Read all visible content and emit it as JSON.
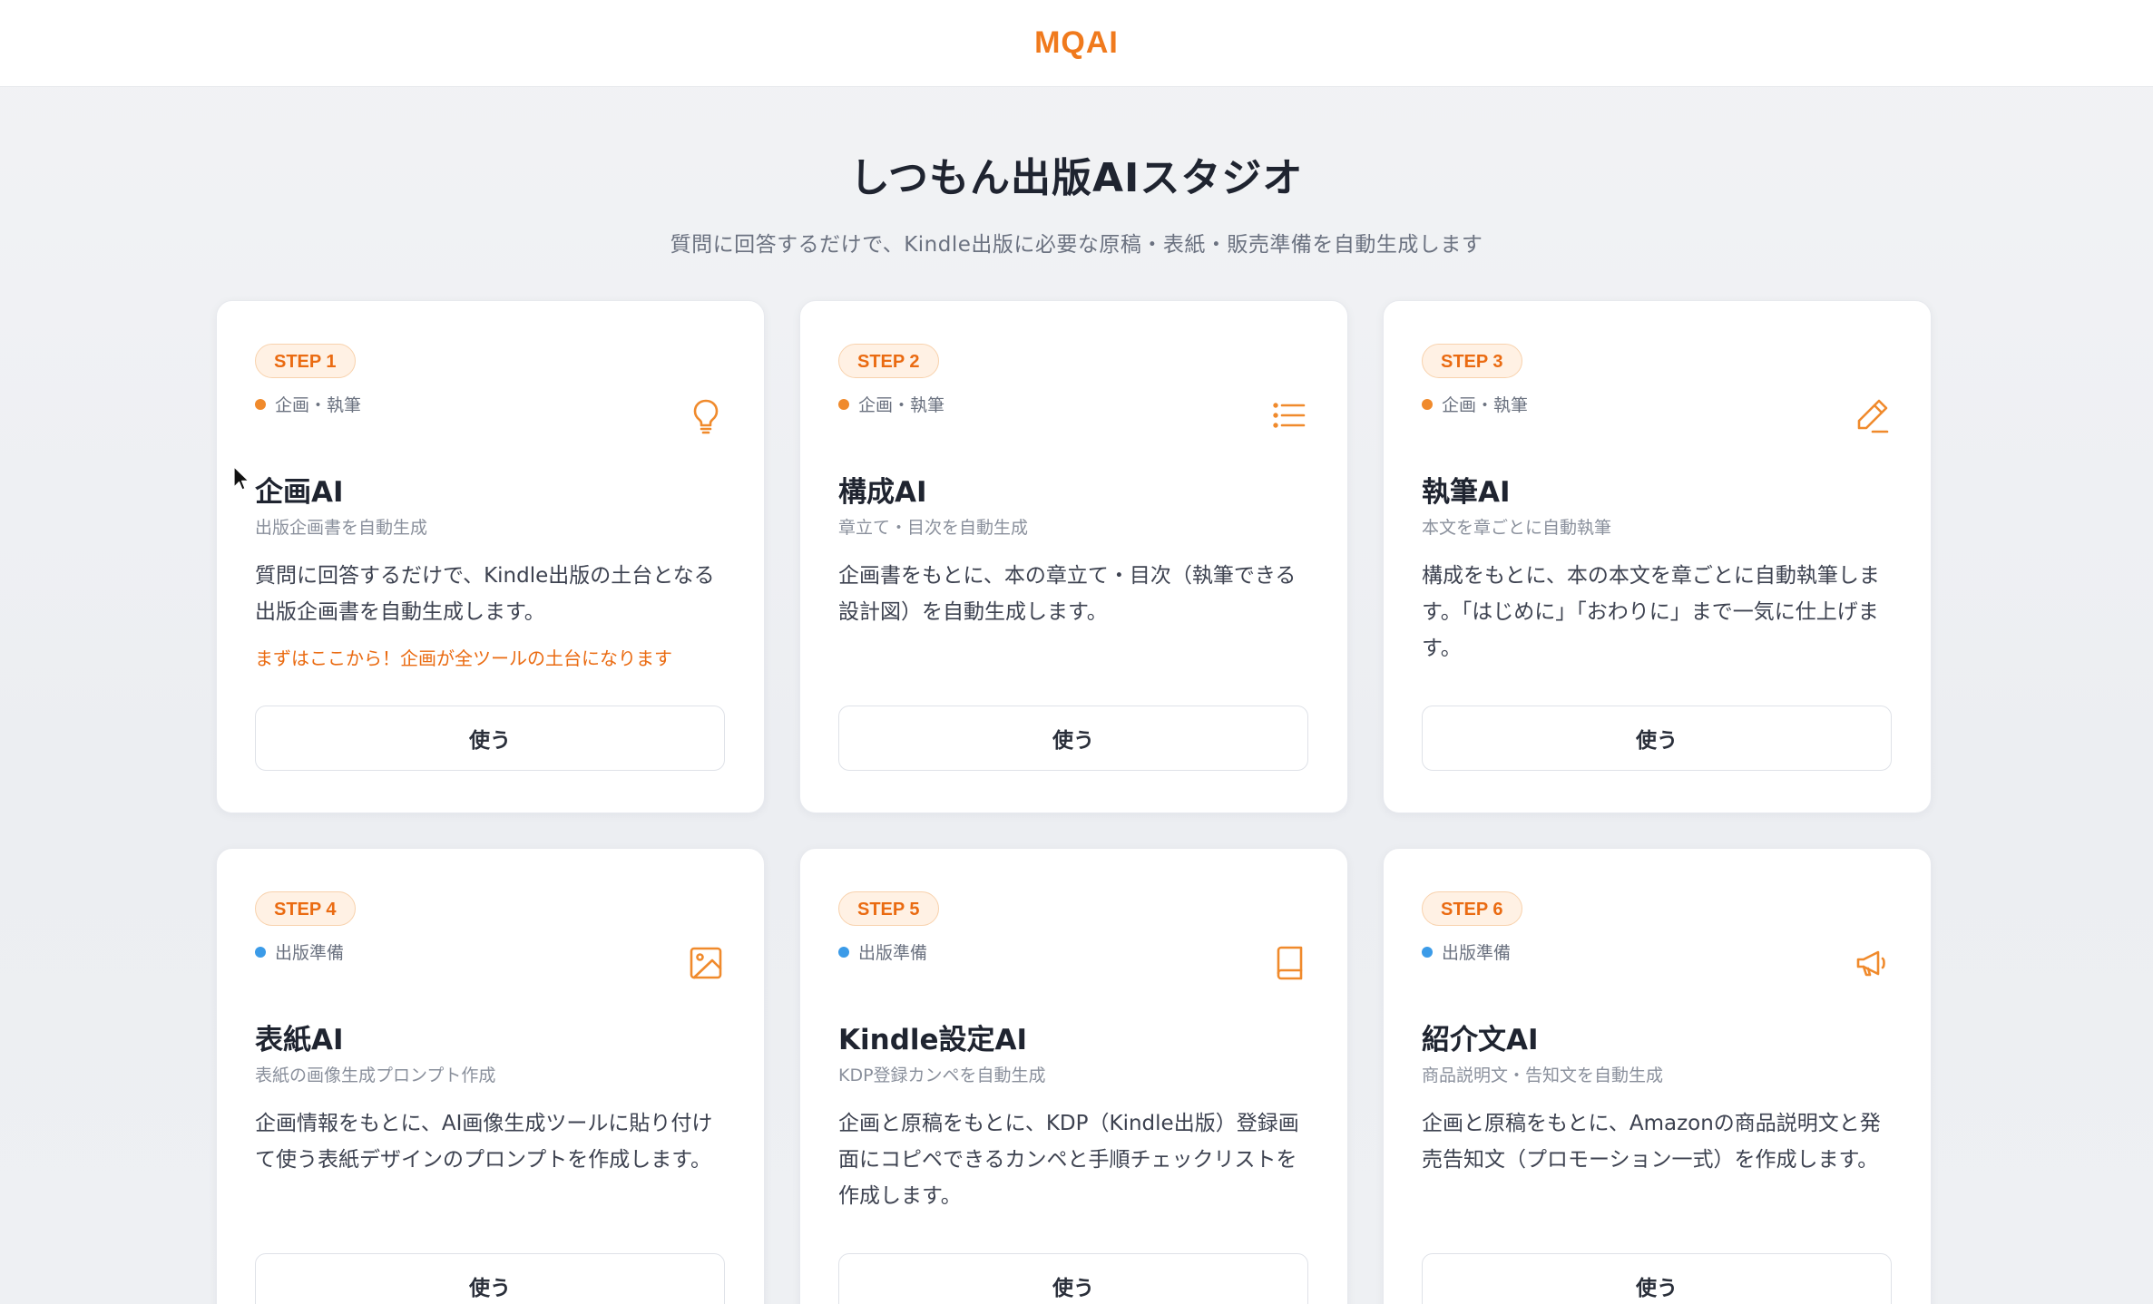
{
  "header": {
    "brand": "MQAI"
  },
  "hero": {
    "title": "しつもん出版AIスタジオ",
    "subtitle": "質問に回答するだけで、Kindle出版に必要な原稿・表紙・販売準備を自動生成します"
  },
  "colors": {
    "accent": "#f07a1d",
    "category_writing": "#f08a2c",
    "category_prep": "#3b9be8"
  },
  "cards": [
    {
      "step": "STEP 1",
      "category": "企画・執筆",
      "icon": "lightbulb-icon",
      "title": "企画AI",
      "subtitle": "出版企画書を自動生成",
      "description": "質問に回答するだけで、Kindle出版の土台となる出版企画書を自動生成します。",
      "note": "まずはここから！企画が全ツールの土台になります",
      "button": "使う"
    },
    {
      "step": "STEP 2",
      "category": "企画・執筆",
      "icon": "list-icon",
      "title": "構成AI",
      "subtitle": "章立て・目次を自動生成",
      "description": "企画書をもとに、本の章立て・目次（執筆できる設計図）を自動生成します。",
      "note": "",
      "button": "使う"
    },
    {
      "step": "STEP 3",
      "category": "企画・執筆",
      "icon": "pencil-icon",
      "title": "執筆AI",
      "subtitle": "本文を章ごとに自動執筆",
      "description": "構成をもとに、本の本文を章ごとに自動執筆します。「はじめに」「おわりに」まで一気に仕上げます。",
      "note": "",
      "button": "使う"
    },
    {
      "step": "STEP 4",
      "category": "出版準備",
      "icon": "image-icon",
      "title": "表紙AI",
      "subtitle": "表紙の画像生成プロンプト作成",
      "description": "企画情報をもとに、AI画像生成ツールに貼り付けて使う表紙デザインのプロンプトを作成します。",
      "note": "",
      "button": "使う"
    },
    {
      "step": "STEP 5",
      "category": "出版準備",
      "icon": "book-icon",
      "title": "Kindle設定AI",
      "subtitle": "KDP登録カンペを自動生成",
      "description": "企画と原稿をもとに、KDP（Kindle出版）登録画面にコピペできるカンペと手順チェックリストを作成します。",
      "note": "",
      "button": "使う"
    },
    {
      "step": "STEP 6",
      "category": "出版準備",
      "icon": "megaphone-icon",
      "title": "紹介文AI",
      "subtitle": "商品説明文・告知文を自動生成",
      "description": "企画と原稿をもとに、Amazonの商品説明文と発売告知文（プロモーション一式）を作成します。",
      "note": "",
      "button": "使う"
    }
  ]
}
